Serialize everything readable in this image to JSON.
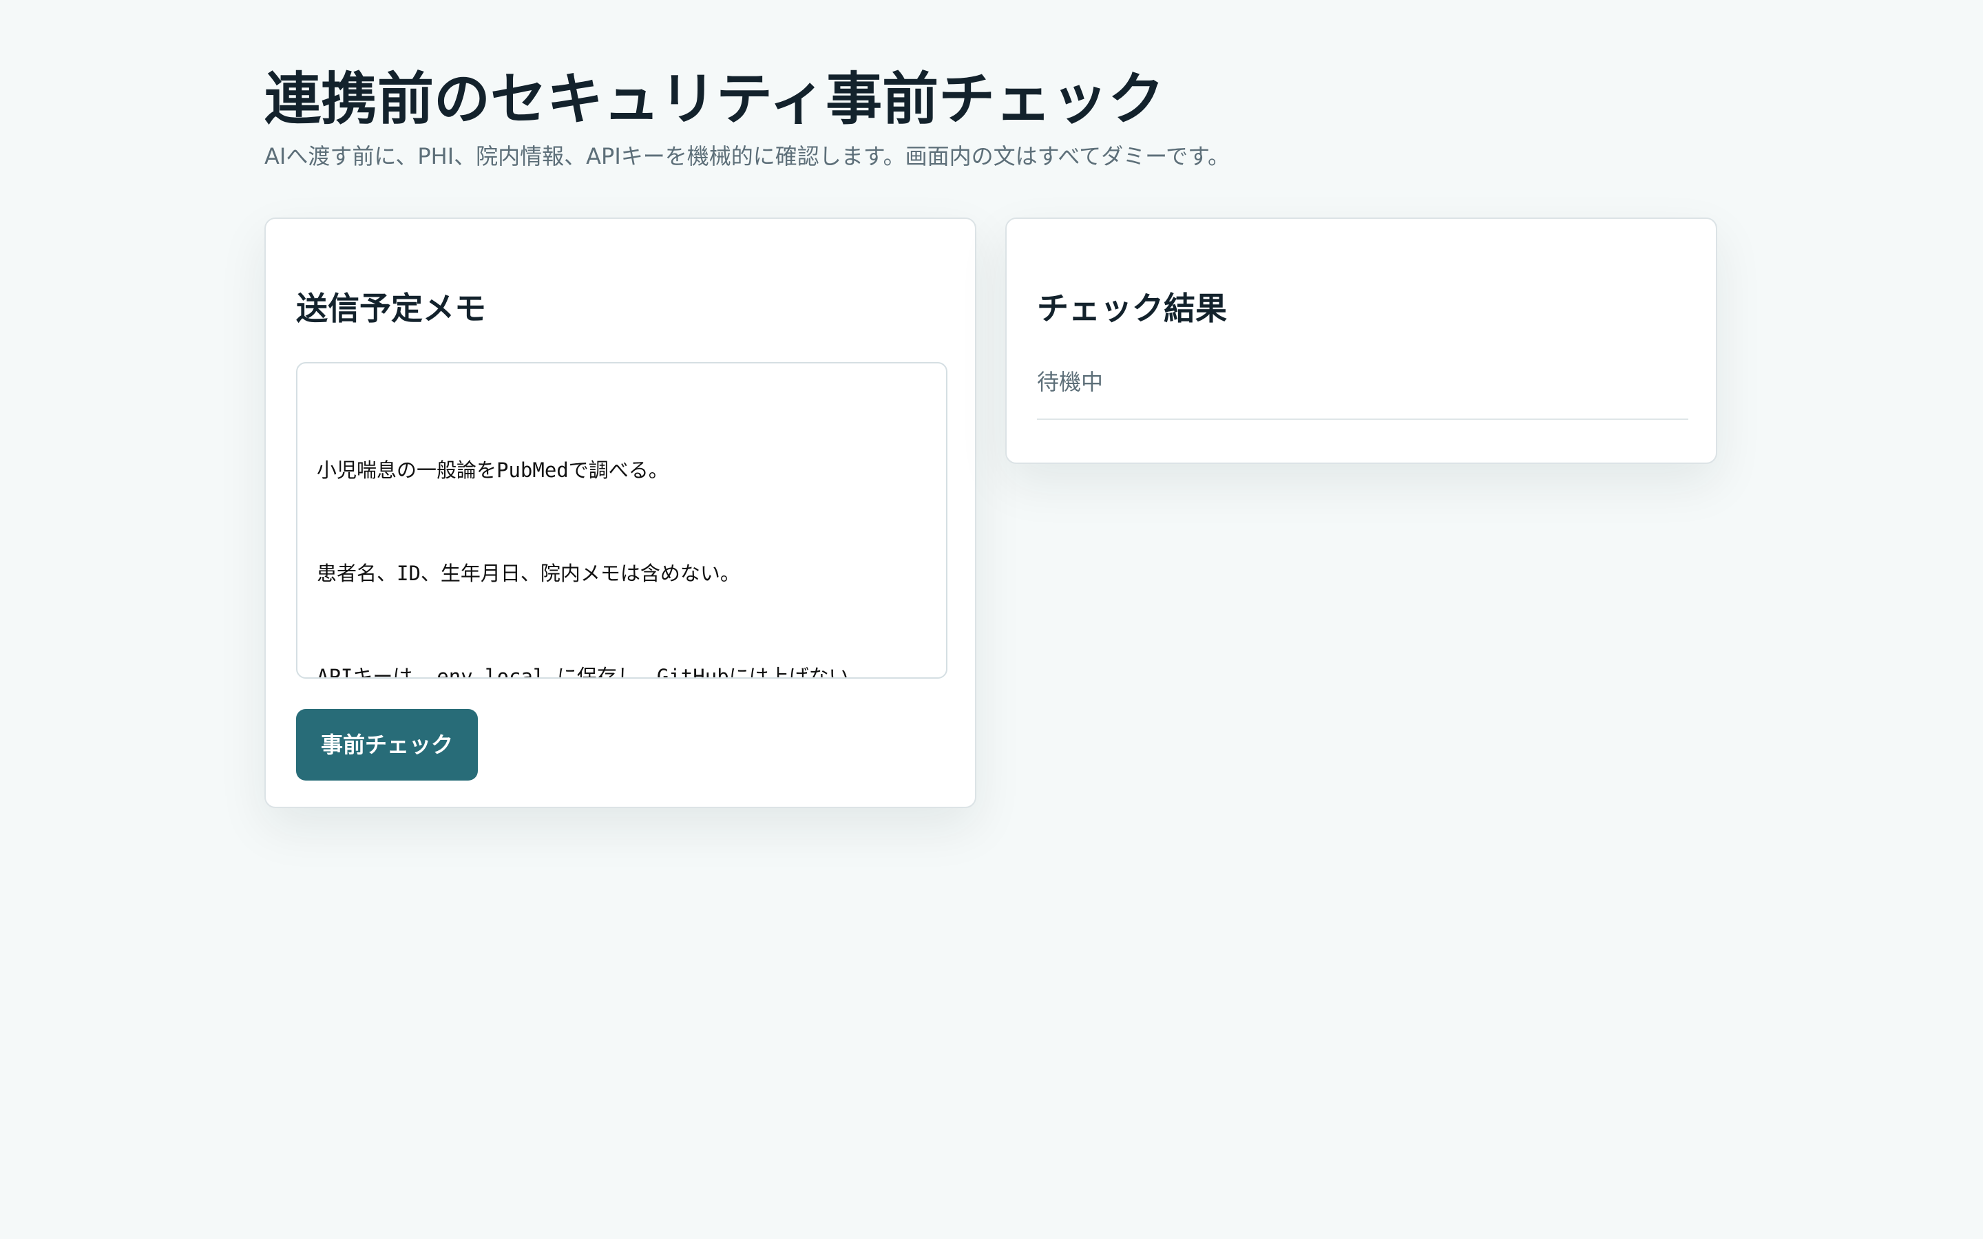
{
  "page": {
    "title": "連携前のセキュリティ事前チェック",
    "subtitle": "AIへ渡す前に、PHI、院内情報、APIキーを機械的に確認します。画面内の文はすべてダミーです。"
  },
  "memo_panel": {
    "title": "送信予定メモ",
    "lines": [
      "小児喘息の一般論をPubMedで調べる。",
      "患者名、ID、生年月日、院内メモは含めない。",
      "APIキーは .env.local に保存し、GitHubには上げない。"
    ],
    "button_label": "事前チェック"
  },
  "result_panel": {
    "title": "チェック結果",
    "status": "待機中"
  },
  "colors": {
    "background": "#f5f9f9",
    "primary_button": "#286c78",
    "heading_text": "#13222c",
    "muted_text": "#5d6f79",
    "border": "#dce3e6"
  }
}
